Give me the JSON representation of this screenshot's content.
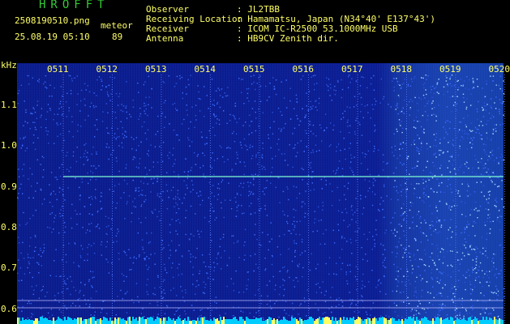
{
  "header": {
    "app_name": "HROFFT",
    "filename": "2508190510.png",
    "datetime": "25.08.19 05:10",
    "mode_label": "meteor",
    "count": "89",
    "observer_label": "Observer",
    "observer_value": ": JL2TBB",
    "location_label": "Receiving Location",
    "location_value": ": Hamamatsu, Japan (N34°40' E137°43')",
    "receiver_label": "Receiver",
    "receiver_value": ": ICOM IC-R2500 53.1000MHz USB",
    "antenna_label": "Antenna",
    "antenna_value": ": HB9CV Zenith dir."
  },
  "spectrogram": {
    "y_unit": "kHz",
    "y_ticks": [
      "1.1",
      "1.0",
      "0.9",
      "0.8",
      "0.7",
      "0.6"
    ],
    "x_ticks": [
      "0511",
      "0512",
      "0513",
      "0514",
      "0515",
      "0516",
      "0517",
      "0518",
      "0519",
      "0520"
    ],
    "carrier_freq_khz": 0.925,
    "colors": {
      "background": "#0a1a88",
      "noise": "#3a6cff",
      "carrier": "#7fffd4",
      "text": "#ffff66",
      "title": "#33cc33",
      "meter": "#00ccff"
    }
  }
}
